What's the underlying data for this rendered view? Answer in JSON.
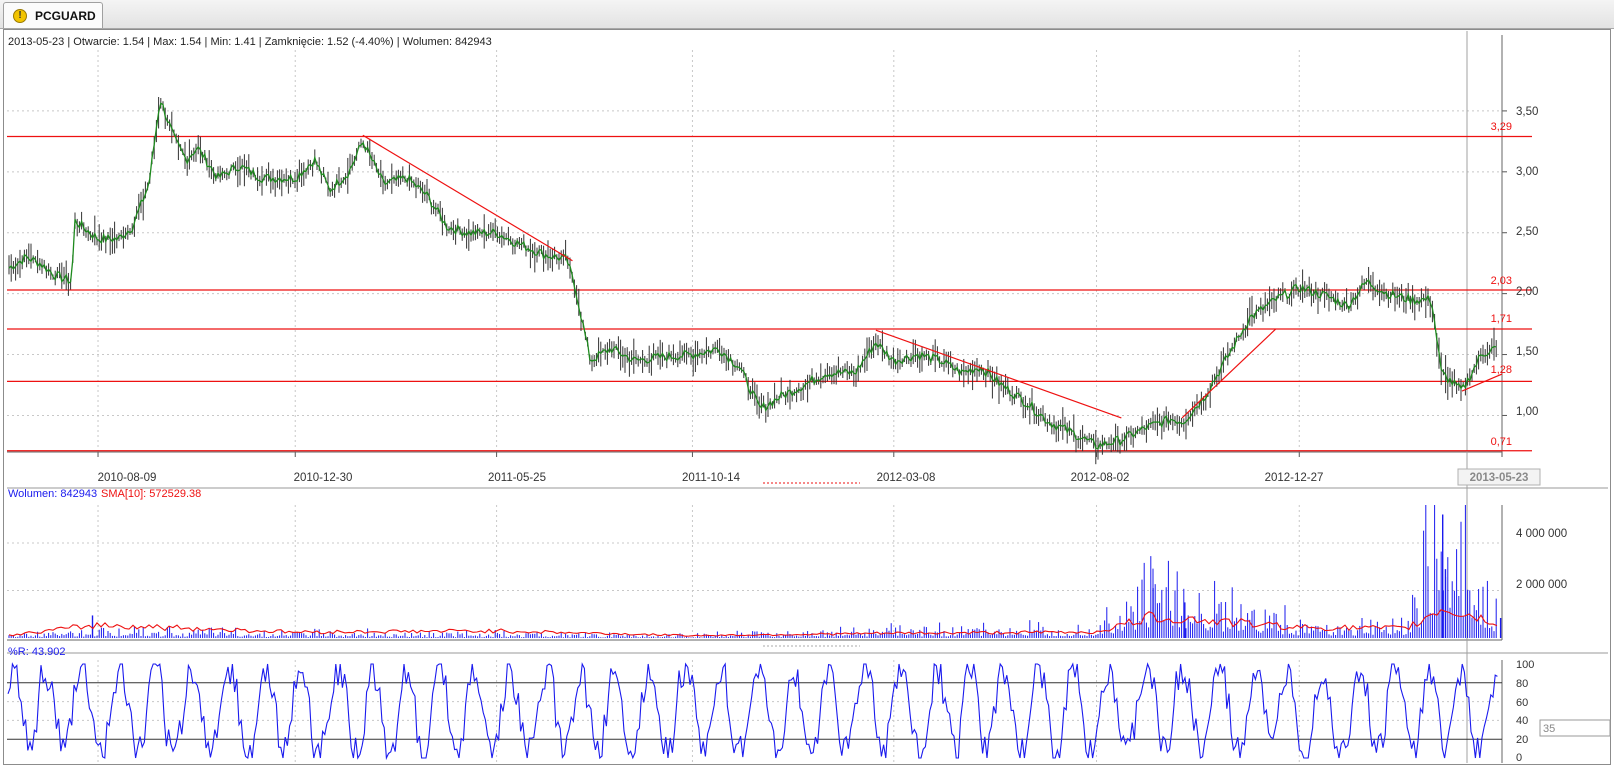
{
  "tab": {
    "label": "PCGUARD",
    "icon": "warning-icon"
  },
  "header": {
    "date": "2013-05-23",
    "open": "Otwarcie: 1.54",
    "max": "Max: 1.54",
    "min": "Min: 1.41",
    "close": "Zamknięcie: 1.52 (-4.40%)",
    "volume": "Wolumen: 842943"
  },
  "colors": {
    "price_up": "#1e8a1e",
    "price_bar": "#333333",
    "line": "#ee1111",
    "volume": "#1a1aee",
    "sma": "#ee1111",
    "wr": "#1a1aee"
  },
  "chart_data": [
    {
      "type": "line",
      "title": "",
      "x_ticks": [
        "2010-08-09",
        "2010-12-30",
        "2011-05-25",
        "2011-10-14",
        "2012-03-08",
        "2012-08-02",
        "2012-12-27",
        "2013-05-23"
      ],
      "y_ticks": [
        "3,50",
        "3,00",
        "2,50",
        "2,00",
        "1,50",
        "1,00"
      ],
      "ylim": [
        0.7,
        4.0
      ],
      "horizontal_levels": [
        {
          "value": 3.29,
          "label": "3,29"
        },
        {
          "value": 2.03,
          "label": "2,03"
        },
        {
          "value": 1.71,
          "label": "1,71"
        },
        {
          "value": 1.28,
          "label": "1,28"
        },
        {
          "value": 0.71,
          "label": "0,71"
        }
      ],
      "trend_lines": [
        {
          "from": [
            "2011-02-17",
            3.3
          ],
          "to": [
            "2011-07-19",
            2.27
          ]
        },
        {
          "from": [
            "2012-02-24",
            1.7
          ],
          "to": [
            "2012-08-20",
            0.98
          ]
        },
        {
          "from": [
            "2012-10-03",
            0.98
          ],
          "to": [
            "2012-12-10",
            1.71
          ]
        },
        {
          "from": [
            "2013-04-24",
            1.2
          ],
          "to": [
            "2013-05-23",
            1.34
          ]
        }
      ],
      "series": [
        {
          "x": [
            "2010-06-04",
            "2010-06-18",
            "2010-06-28",
            "2010-07-09",
            "2010-07-21",
            "2010-07-23",
            "2010-08-09",
            "2010-08-24",
            "2010-09-03",
            "2010-09-15",
            "2010-09-23",
            "2010-10-04",
            "2010-10-12",
            "2010-10-20",
            "2010-11-04",
            "2010-11-19",
            "2010-12-06",
            "2010-12-30",
            "2011-01-13",
            "2011-01-24",
            "2011-02-07",
            "2011-02-17",
            "2011-03-04",
            "2011-03-21",
            "2011-04-05",
            "2011-04-19",
            "2011-05-04",
            "2011-05-25",
            "2011-06-08",
            "2011-06-29",
            "2011-07-15",
            "2011-07-22",
            "2011-08-01",
            "2011-08-16",
            "2011-09-02",
            "2011-09-22",
            "2011-10-14",
            "2011-11-02",
            "2011-11-17",
            "2011-12-02",
            "2011-12-16",
            "2012-01-03",
            "2012-01-19",
            "2012-02-09",
            "2012-02-24",
            "2012-03-08",
            "2012-03-26",
            "2012-04-11",
            "2012-04-26",
            "2012-05-10",
            "2012-05-25",
            "2012-06-13",
            "2012-06-28",
            "2012-07-17",
            "2012-08-02",
            "2012-08-20",
            "2012-09-07",
            "2012-09-25",
            "2012-10-04",
            "2012-10-19",
            "2012-11-06",
            "2012-11-21",
            "2012-12-10",
            "2012-12-27",
            "2013-01-16",
            "2013-01-31",
            "2013-02-14",
            "2013-03-01",
            "2013-03-18",
            "2013-04-02",
            "2013-04-09",
            "2013-04-24",
            "2013-05-08",
            "2013-05-17",
            "2013-05-23"
          ],
          "y": [
            2.2,
            2.3,
            2.25,
            2.15,
            2.1,
            2.6,
            2.45,
            2.45,
            2.55,
            2.9,
            3.6,
            3.25,
            3.1,
            3.2,
            2.95,
            3.05,
            2.95,
            2.95,
            3.1,
            2.85,
            3.0,
            3.25,
            2.9,
            2.95,
            2.8,
            2.55,
            2.5,
            2.5,
            2.42,
            2.32,
            2.28,
            2.0,
            1.45,
            1.55,
            1.45,
            1.48,
            1.5,
            1.55,
            1.4,
            1.05,
            1.15,
            1.25,
            1.35,
            1.35,
            1.6,
            1.45,
            1.5,
            1.45,
            1.35,
            1.4,
            1.25,
            1.1,
            0.95,
            0.85,
            0.75,
            0.8,
            0.9,
            0.97,
            0.95,
            1.15,
            1.5,
            1.8,
            1.95,
            2.05,
            1.98,
            1.9,
            2.1,
            2.0,
            1.95,
            1.95,
            1.35,
            1.2,
            1.5,
            1.55,
            1.52
          ]
        }
      ]
    },
    {
      "type": "bar",
      "title": "",
      "legend": [
        "Wolumen: 842943",
        "SMA[10]: 572529.38"
      ],
      "y_ticks": [
        "4 000 000",
        "2 000 000"
      ],
      "ylim": [
        0,
        5600000
      ],
      "series": [
        {
          "name": "Wolumen",
          "x": [
            "2010-06-04",
            "2010-08-09",
            "2010-12-30",
            "2011-05-25",
            "2011-10-14",
            "2012-03-08",
            "2012-08-02",
            "2012-09-12",
            "2012-12-27",
            "2013-03-15",
            "2013-04-10",
            "2013-05-23"
          ],
          "values": [
            150000,
            300000,
            200000,
            150000,
            100000,
            300000,
            400000,
            2100000,
            500000,
            500000,
            5200000,
            842943
          ]
        },
        {
          "name": "SMA[10]",
          "x": [
            "2010-06-04",
            "2010-08-09",
            "2010-12-30",
            "2011-05-25",
            "2011-10-14",
            "2012-03-08",
            "2012-08-02",
            "2012-09-12",
            "2012-12-27",
            "2013-03-15",
            "2013-04-10",
            "2013-05-23"
          ],
          "values": [
            100000,
            550000,
            250000,
            300000,
            100000,
            200000,
            250000,
            900000,
            450000,
            400000,
            1250000,
            572529.38
          ]
        }
      ]
    },
    {
      "type": "line",
      "title": "",
      "legend": [
        "%R: 43.902"
      ],
      "y_ticks": [
        "100",
        "80",
        "60",
        "40",
        "20",
        "0"
      ],
      "ylim": [
        0,
        100
      ],
      "horizontal_levels": [
        80,
        20
      ],
      "current_marker": "35",
      "series": [
        {
          "name": "%R",
          "x": [
            "2010-06-04",
            "2010-08-09",
            "2010-12-30",
            "2011-05-25",
            "2011-10-14",
            "2012-03-08",
            "2012-08-02",
            "2012-12-27",
            "2013-05-23"
          ],
          "values": [
            90,
            50,
            40,
            60,
            30,
            70,
            20,
            80,
            43.902
          ]
        }
      ]
    }
  ]
}
